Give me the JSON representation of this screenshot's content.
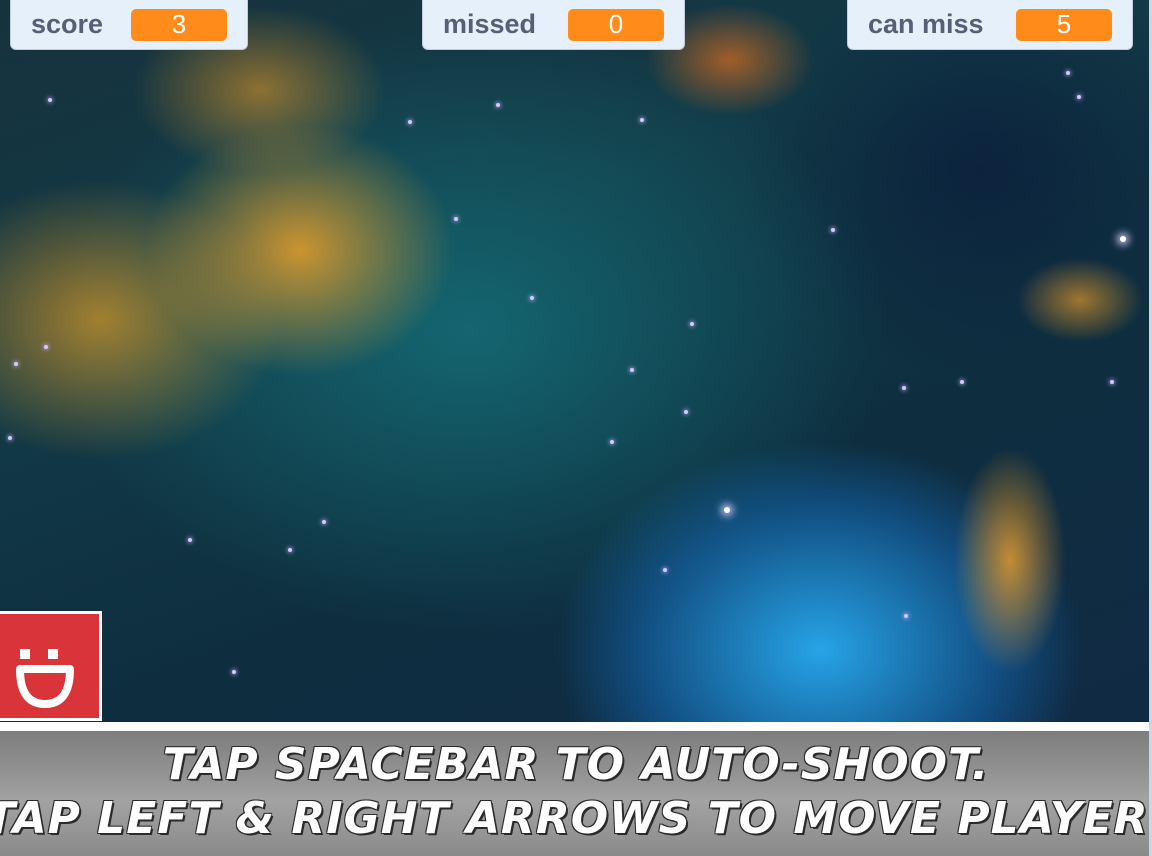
{
  "monitors": {
    "score": {
      "label": "score",
      "value": "3"
    },
    "missed": {
      "label": "missed",
      "value": "0"
    },
    "can_miss": {
      "label": "can miss",
      "value": "5"
    }
  },
  "banner": {
    "line1": "TAP SPACEBAR TO AUTO-SHOOT.",
    "line2": "TAP LEFT & RIGHT ARROWS TO MOVE PLAYER."
  },
  "sprites": {
    "player_icon": "smiley-face-icon"
  },
  "colors": {
    "monitor_value_bg": "#ff8c1a",
    "monitor_bg": "#e6f0fb",
    "monitor_label": "#575e75",
    "sprite_bg": "#d8343a"
  }
}
